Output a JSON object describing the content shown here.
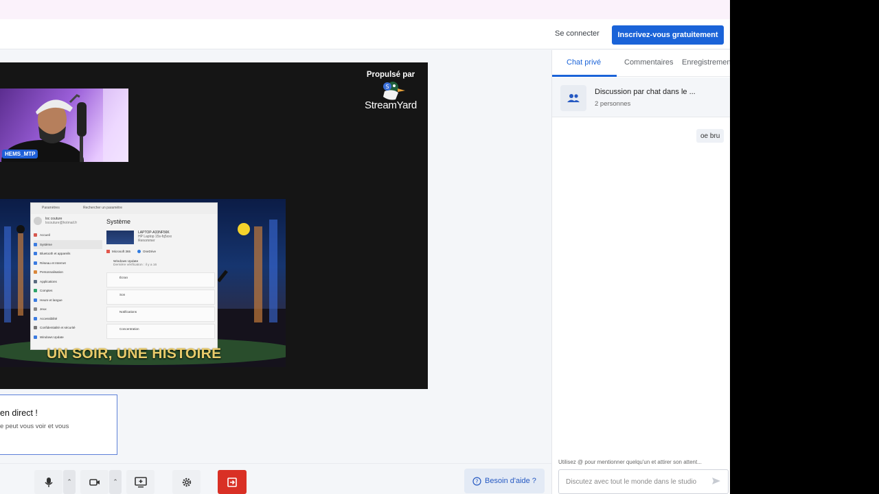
{
  "header": {
    "login_label": "Se connecter",
    "signup_label": "Inscrivez-vous gratuitement"
  },
  "stage": {
    "powered_by": "Propulsé par",
    "brand_name": "StreamYard",
    "camera_name": "HEMS_MTP",
    "share_caption": "UN SOIR, UNE HISTOIRE",
    "window": {
      "search_placeholder": "Rechercher un paramètre",
      "title_left": "Paramètres",
      "heading": "Système",
      "user_name": "loc couture",
      "user_email": "locouture@hotmail.fr",
      "nav_items": [
        "Accueil",
        "Système",
        "Bluetooth et appareils",
        "Réseau et Internet",
        "Personnalisation",
        "Applications",
        "Comptes",
        "Heure et langue",
        "Jeux",
        "Accessibilité",
        "Confidentialité et sécurité",
        "Windows Update"
      ],
      "device_name": "LAPTOP-A33NF56K",
      "device_model": "HP Laptop 15s-fq5xxx",
      "device_rename": "Renommer",
      "app_ms365": "Microsoft 365",
      "app_onedrive": "OneDrive",
      "update_title": "Windows Update",
      "update_sub": "Dernière vérification : il y a 16",
      "cards": [
        "Écran",
        "Son",
        "Notifications",
        "Concentration"
      ]
    }
  },
  "banner": {
    "title": "en direct !",
    "text": "e peut vous voir et vous"
  },
  "controls": {
    "help_label": "Besoin d'aide ?"
  },
  "sidepanel": {
    "tabs": [
      "Chat privé",
      "Commentaires",
      "Enregistrement"
    ],
    "chat_title": "Discussion par chat dans le ...",
    "chat_members": "2 personnes",
    "message": "oe bru",
    "hint": "Utilisez @ pour mentionner quelqu'un et attirer son attent...",
    "input_placeholder": "Discutez avec tout le monde dans le studio"
  },
  "colors": {
    "accent": "#1a63d8",
    "leave": "#d93025",
    "stage_bg": "#151515",
    "caption": "#e8ca6a"
  },
  "icons": [
    "microphone-icon",
    "camera-icon",
    "screen-share-icon",
    "gear-icon",
    "leave-icon",
    "help-icon",
    "people-icon",
    "send-icon",
    "chevron-up-icon"
  ]
}
